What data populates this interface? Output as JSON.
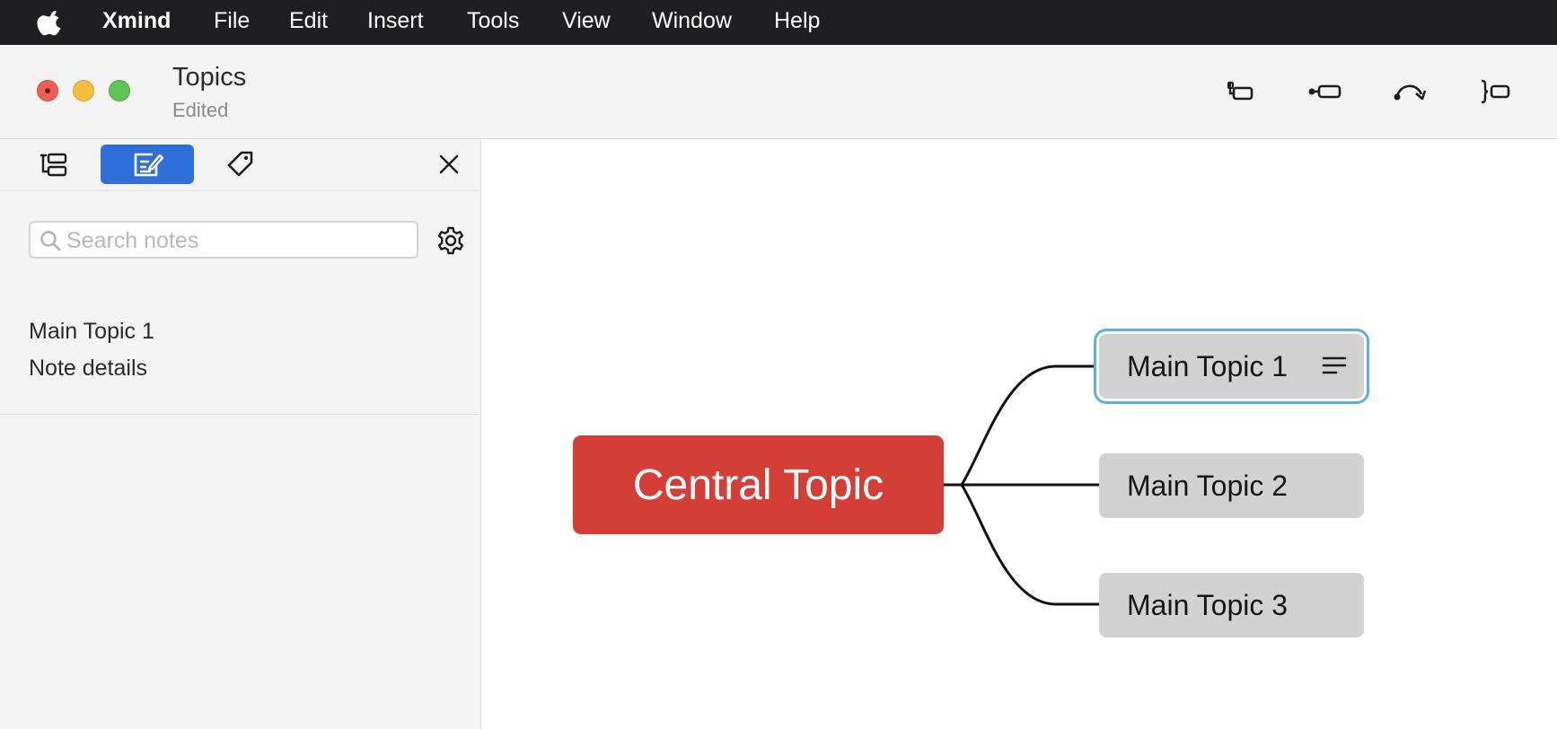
{
  "menubar": {
    "apple_icon": "apple-logo-icon",
    "app_name": "Xmind",
    "items": [
      "File",
      "Edit",
      "Insert",
      "Tools",
      "View",
      "Window",
      "Help"
    ]
  },
  "window": {
    "title": "Topics",
    "status": "Edited",
    "toolbar_icons": [
      "subtopic-icon",
      "floating-topic-icon",
      "relationship-icon",
      "summary-icon"
    ]
  },
  "sidebar": {
    "tabs": [
      {
        "icon": "outliner-icon",
        "active": false
      },
      {
        "icon": "notes-icon",
        "active": true
      },
      {
        "icon": "tag-icon",
        "active": false
      }
    ],
    "search_placeholder": "Search notes",
    "note": {
      "topic": "Main Topic 1",
      "body": "Note details"
    }
  },
  "map": {
    "central_topic": "Central Topic",
    "main_topics": [
      {
        "label": "Main Topic 1",
        "has_note": true,
        "selected": true
      },
      {
        "label": "Main Topic 2",
        "has_note": false,
        "selected": false
      },
      {
        "label": "Main Topic 3",
        "has_note": false,
        "selected": false
      }
    ],
    "colors": {
      "central": "#d33f37",
      "topic": "#d2d2d2",
      "selection": "#5aaeea",
      "active_tab": "#2e6fd9"
    }
  }
}
